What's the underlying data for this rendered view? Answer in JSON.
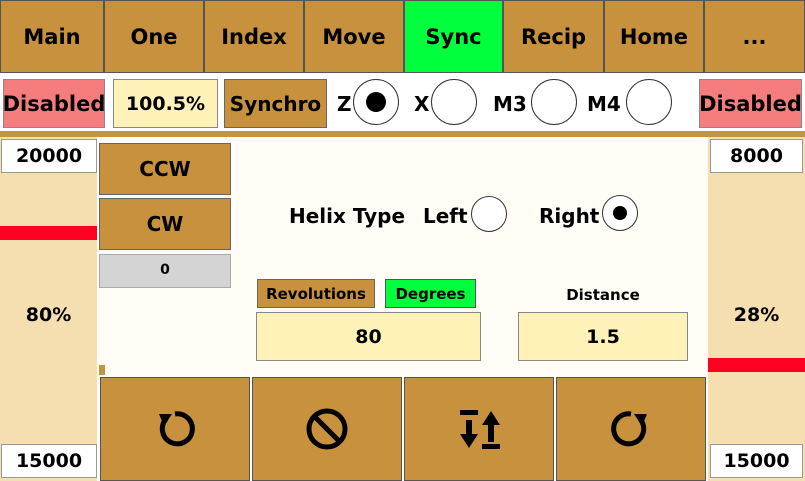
{
  "tabs": [
    {
      "label": "Main"
    },
    {
      "label": "One"
    },
    {
      "label": "Index"
    },
    {
      "label": "Move"
    },
    {
      "label": "Sync"
    },
    {
      "label": "Recip"
    },
    {
      "label": "Home"
    },
    {
      "label": "..."
    }
  ],
  "active_tab": "Sync",
  "status_left": "Disabled",
  "status_right": "Disabled",
  "speed_percent": "100.5%",
  "synchro_label": "Synchro",
  "axes": [
    {
      "label": "Z",
      "selected": true
    },
    {
      "label": "X",
      "selected": false
    },
    {
      "label": "M3",
      "selected": false
    },
    {
      "label": "M4",
      "selected": false
    }
  ],
  "left_column": {
    "top_value": "20000",
    "percent": "80%",
    "bottom_value": "15000",
    "level": 0.8
  },
  "right_column": {
    "top_value": "8000",
    "percent": "28%",
    "bottom_value": "15000",
    "level": 0.28
  },
  "ccw_label": "CCW",
  "cw_label": "CW",
  "counter_value": "0",
  "helix": {
    "title": "Helix Type",
    "left_label": "Left",
    "right_label": "Right",
    "selected": "Right"
  },
  "revolutions_label": "Revolutions",
  "degrees_label": "Degrees",
  "distance_label": "Distance",
  "degrees_value": "80",
  "distance_value": "1.5",
  "colors": {
    "tab": "#c8913e",
    "active": "#00ff3c",
    "disabled": "#f57d7d",
    "marker": "#ff0022"
  },
  "icons": [
    "rotate-ccw-icon",
    "stop-icon",
    "sort-arrows-icon",
    "rotate-cw-icon"
  ]
}
